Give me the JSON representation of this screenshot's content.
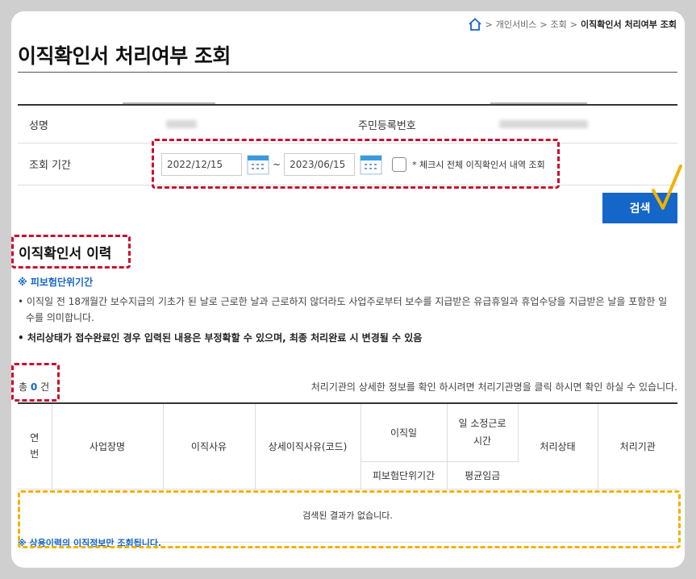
{
  "breadcrumb": {
    "items": [
      "개인서비스",
      "조회",
      "이직확인서 처리여부 조회"
    ]
  },
  "page": {
    "title": "이직확인서 처리여부 조회"
  },
  "form": {
    "name_label": "성명",
    "rrn_label": "주민등록번호",
    "period_label": "조회 기간",
    "start_date": "2022/12/15",
    "end_date": "2023/06/15",
    "tilde": "~",
    "check_note": "* 체크시 전체 이직확인서 내역 조회",
    "search_button": "검색"
  },
  "history": {
    "section_title": "이직확인서 이력",
    "note_head": "※ 피보험단위기간",
    "desc_line": "• 이직일 전 18개월간 보수지급의 기초가 된 날로 근로한 날과 근로하지 않더라도 사업주로부터 보수를 지급받은 유급휴일과 휴업수당을 지급받은 날을 포함한 일수를 의미합니다.",
    "bold_line": "• 처리상태가 접수완료인 경우 입력된 내용은 부정확할 수 있으며, 최종 처리완료 시 변경될 수 있음",
    "count_prefix": "총",
    "count_value": "0",
    "count_suffix": "건",
    "info_right": "처리기관의 상세한 정보를 확인 하시려면 처리기관명을 클릭 하시면 확인 하실 수 있습니다."
  },
  "table": {
    "headers": {
      "no": "연\n번",
      "company": "사업장명",
      "reason": "이직사유",
      "detail_reason": "상세이직사유(코드)",
      "leave_date": "이직일",
      "work_hours": "일 소정근로\n시간",
      "status": "처리상태",
      "agency": "처리기관",
      "insured_period": "피보험단위기간",
      "avg_wage": "평균임금"
    },
    "empty_message": "검색된 결과가 없습니다."
  },
  "footnote": "※ 상용이력의 이직정보만 조회됩니다.",
  "colors": {
    "primary_blue": "#1466c8",
    "red_dashed": "#c8102e",
    "yellow_dashed": "#f2b100",
    "check_mark": "#f2b100"
  }
}
